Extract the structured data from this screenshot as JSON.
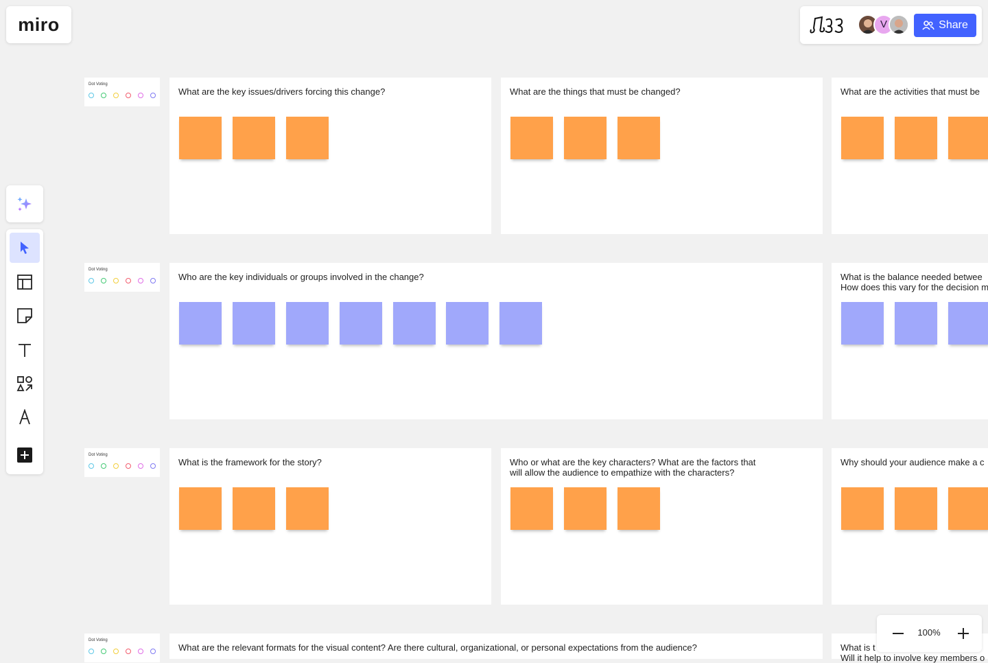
{
  "brand": {
    "logo_text": "miro"
  },
  "header": {
    "board_icon": "board-logo-icon",
    "avatars": [
      {
        "name": "avatar-user-1"
      },
      {
        "name": "avatar-user-v",
        "initial": "V"
      },
      {
        "name": "avatar-user-3"
      }
    ],
    "share_label": "Share"
  },
  "toolbar": {
    "tools": [
      "ai-sparkle-icon",
      "select-cursor-icon",
      "templates-icon",
      "sticky-note-icon",
      "text-icon",
      "shapes-icon",
      "pen-icon",
      "add-icon"
    ],
    "active": "select-cursor-icon"
  },
  "dot_voting": {
    "label": "Dot Voting",
    "colors": [
      "#5dc7e6",
      "#43c974",
      "#f2cf3c",
      "#f25c6d",
      "#e06de6",
      "#7f79f2"
    ]
  },
  "sticky_colors": {
    "orange": "#ffa14a",
    "purple": "#a0a8fb"
  },
  "frames": [
    {
      "question": "What are the key issues/drivers forcing this change?",
      "stickies": 3,
      "color": "orange"
    },
    {
      "question": "What are the things that must be changed?",
      "stickies": 3,
      "color": "orange"
    },
    {
      "question": "What are the activities that must be",
      "stickies": 3,
      "color": "orange"
    },
    {
      "question": "Who are the key individuals or groups involved in the change?",
      "stickies": 7,
      "color": "purple"
    },
    {
      "question": "What is the balance needed betwee",
      "question2": "How does this vary for the decision m",
      "stickies": 3,
      "color": "purple"
    },
    {
      "question": "What is the framework for the story?",
      "stickies": 3,
      "color": "orange"
    },
    {
      "question": "Who or what are the key characters? What are the factors that",
      "question2": "will allow the audience to empathize with the characters?",
      "stickies": 3,
      "color": "orange"
    },
    {
      "question": "Why should your audience make a c",
      "stickies": 3,
      "color": "orange"
    },
    {
      "question": "What are the relevant formats for the visual content? Are there cultural, organizational, or personal expectations from the audience?",
      "stickies": 0,
      "color": "orange"
    },
    {
      "question": "What is t",
      "question2": "Will it help to involve key members o",
      "stickies": 0,
      "color": "orange"
    }
  ],
  "zoom": {
    "value": "100%",
    "minus_icon": "zoom-out-icon",
    "plus_icon": "zoom-in-icon"
  }
}
